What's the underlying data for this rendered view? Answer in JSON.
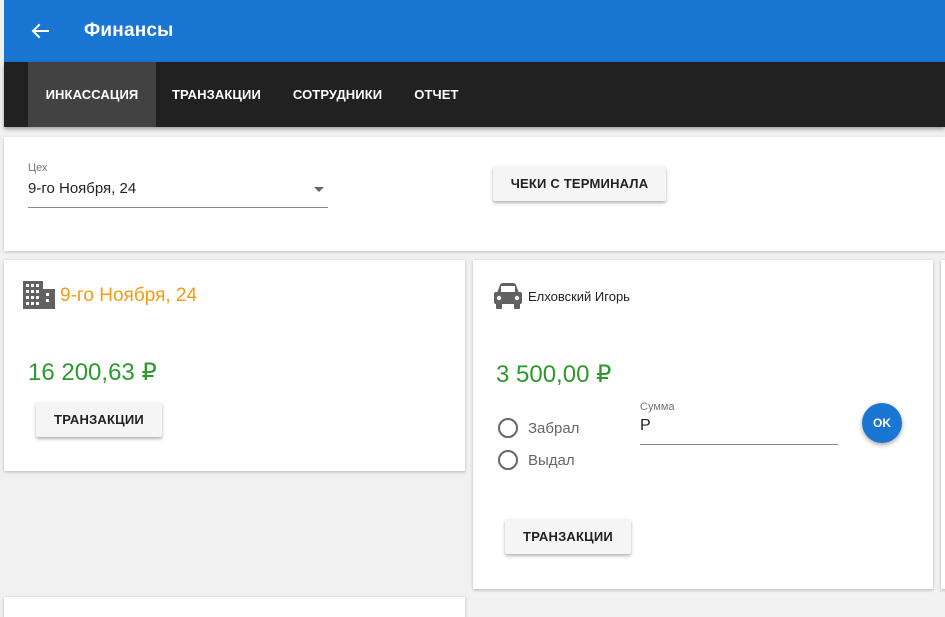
{
  "appbar": {
    "title": "Финансы",
    "back_icon": "arrow-left-icon"
  },
  "tabs": [
    {
      "label": "ИНКАССАЦИЯ",
      "active": true
    },
    {
      "label": "ТРАНЗАКЦИИ",
      "active": false
    },
    {
      "label": "СОТРУДНИКИ",
      "active": false
    },
    {
      "label": "ОТЧЕТ",
      "active": false
    }
  ],
  "filter": {
    "workshop_label": "Цех",
    "workshop_value": "9-го Ноября, 24",
    "receipts_button": "ЧЕКИ С ТЕРМИНАЛА"
  },
  "cards": [
    {
      "icon": "building-icon",
      "name": "9-го Ноября, 24",
      "amount": "16 200,63 ₽",
      "button": "ТРАНЗАКЦИИ"
    },
    {
      "icon": "car-icon",
      "name": "Елховский Игорь",
      "amount": "3 500,00 ₽",
      "radio_took": "Забрал",
      "radio_gave": "Выдал",
      "sum_label": "Сумма",
      "sum_value": "Р",
      "ok_button": "OK",
      "button": "ТРАНЗАКЦИИ"
    }
  ],
  "colors": {
    "primary": "#1976d2",
    "tabbar": "#212121",
    "name_accent": "#f39c12",
    "amount": "#2e9a2e"
  }
}
